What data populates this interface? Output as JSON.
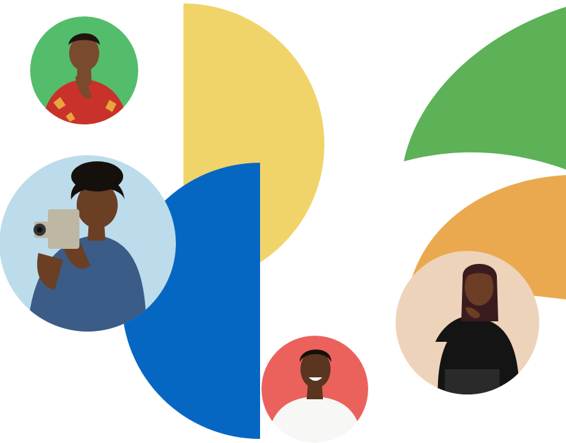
{
  "palette": {
    "yellow": "#F0D46A",
    "blue": "#0667C3",
    "green": "#5DB157",
    "orange": "#EAA94E",
    "portrait_green": "#54BD6B",
    "portrait_light_blue": "#BDDCEB",
    "portrait_red": "#EB625C",
    "portrait_peach": "#EED3BB"
  },
  "portraits": [
    {
      "name": "portrait-man-patterned-shirt",
      "bg": "#54BD6B",
      "skin": "#7A4A2E",
      "hair": "#1E1410",
      "shirt": "#C9322A",
      "accent": "#E7A63A"
    },
    {
      "name": "portrait-man-vintage-camera",
      "bg": "#BDDCEB",
      "skin": "#6A3F24",
      "hair": "#15100C",
      "shirt": "#3A5C87",
      "accent": "#BEB7A4"
    },
    {
      "name": "portrait-man-white-shirt",
      "bg": "#EB625C",
      "skin": "#5A3520",
      "hair": "#16100C",
      "shirt": "#F7F7F5",
      "accent": "#FFFFFF"
    },
    {
      "name": "portrait-woman-black-top",
      "bg": "#EED3BB",
      "skin": "#6B3E25",
      "hair": "#3A1C1E",
      "shirt": "#141414",
      "accent": "#2A2A2A"
    }
  ]
}
